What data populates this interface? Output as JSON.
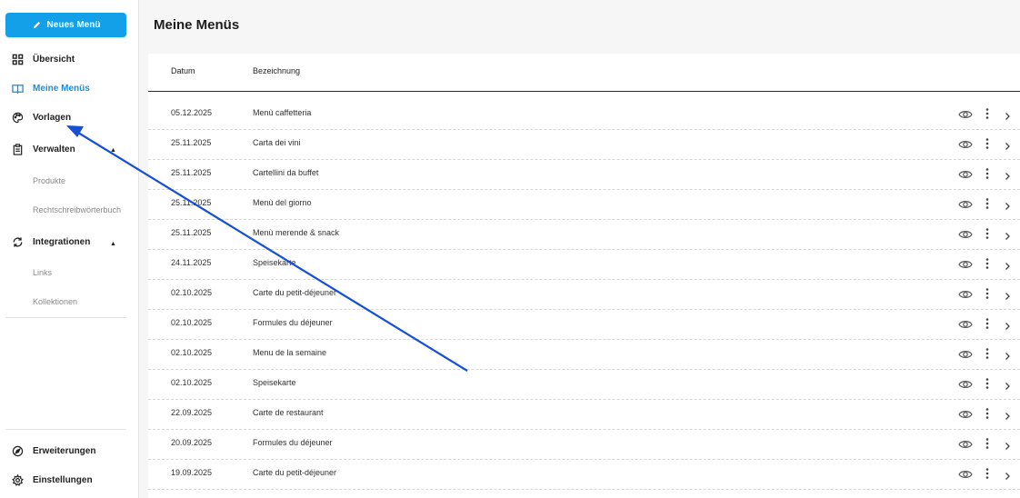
{
  "sidebar": {
    "new_button": "Neues Menü",
    "items": [
      {
        "label": "Übersicht"
      },
      {
        "label": "Meine Menüs"
      },
      {
        "label": "Vorlagen"
      },
      {
        "label": "Verwalten"
      },
      {
        "label": "Produkte"
      },
      {
        "label": "Rechtschreibwörterbuch"
      },
      {
        "label": "Integrationen"
      },
      {
        "label": "Links"
      },
      {
        "label": "Kollektionen"
      },
      {
        "label": "Erweiterungen"
      },
      {
        "label": "Einstellungen"
      }
    ],
    "active_color": "#1a8fd8",
    "accent": "#13a0e8"
  },
  "main": {
    "title": "Meine Menüs",
    "columns": [
      "Datum",
      "Bezeichnung"
    ],
    "rows": [
      {
        "date": "05.12.2025",
        "name": "Menù caffetteria"
      },
      {
        "date": "25.11.2025",
        "name": "Carta dei vini"
      },
      {
        "date": "25.11.2025",
        "name": "Cartellini da buffet"
      },
      {
        "date": "25.11.2025",
        "name": "Menù del giorno"
      },
      {
        "date": "25.11.2025",
        "name": "Menù merende & snack"
      },
      {
        "date": "24.11.2025",
        "name": "Speisekarte"
      },
      {
        "date": "02.10.2025",
        "name": "Carte du petit-déjeuner"
      },
      {
        "date": "02.10.2025",
        "name": "Formules du déjeuner"
      },
      {
        "date": "02.10.2025",
        "name": "Menu de la semaine"
      },
      {
        "date": "02.10.2025",
        "name": "Speisekarte"
      },
      {
        "date": "22.09.2025",
        "name": "Carte de restaurant"
      },
      {
        "date": "20.09.2025",
        "name": "Formules du déjeuner"
      },
      {
        "date": "19.09.2025",
        "name": "Carte du petit-déjeuner"
      }
    ],
    "row_icons": [
      "eye-icon",
      "more-vertical-icon",
      "chevron-right-icon"
    ]
  },
  "annotation": {
    "type": "arrow",
    "color": "#1550d8",
    "target": "Vorlagen"
  }
}
